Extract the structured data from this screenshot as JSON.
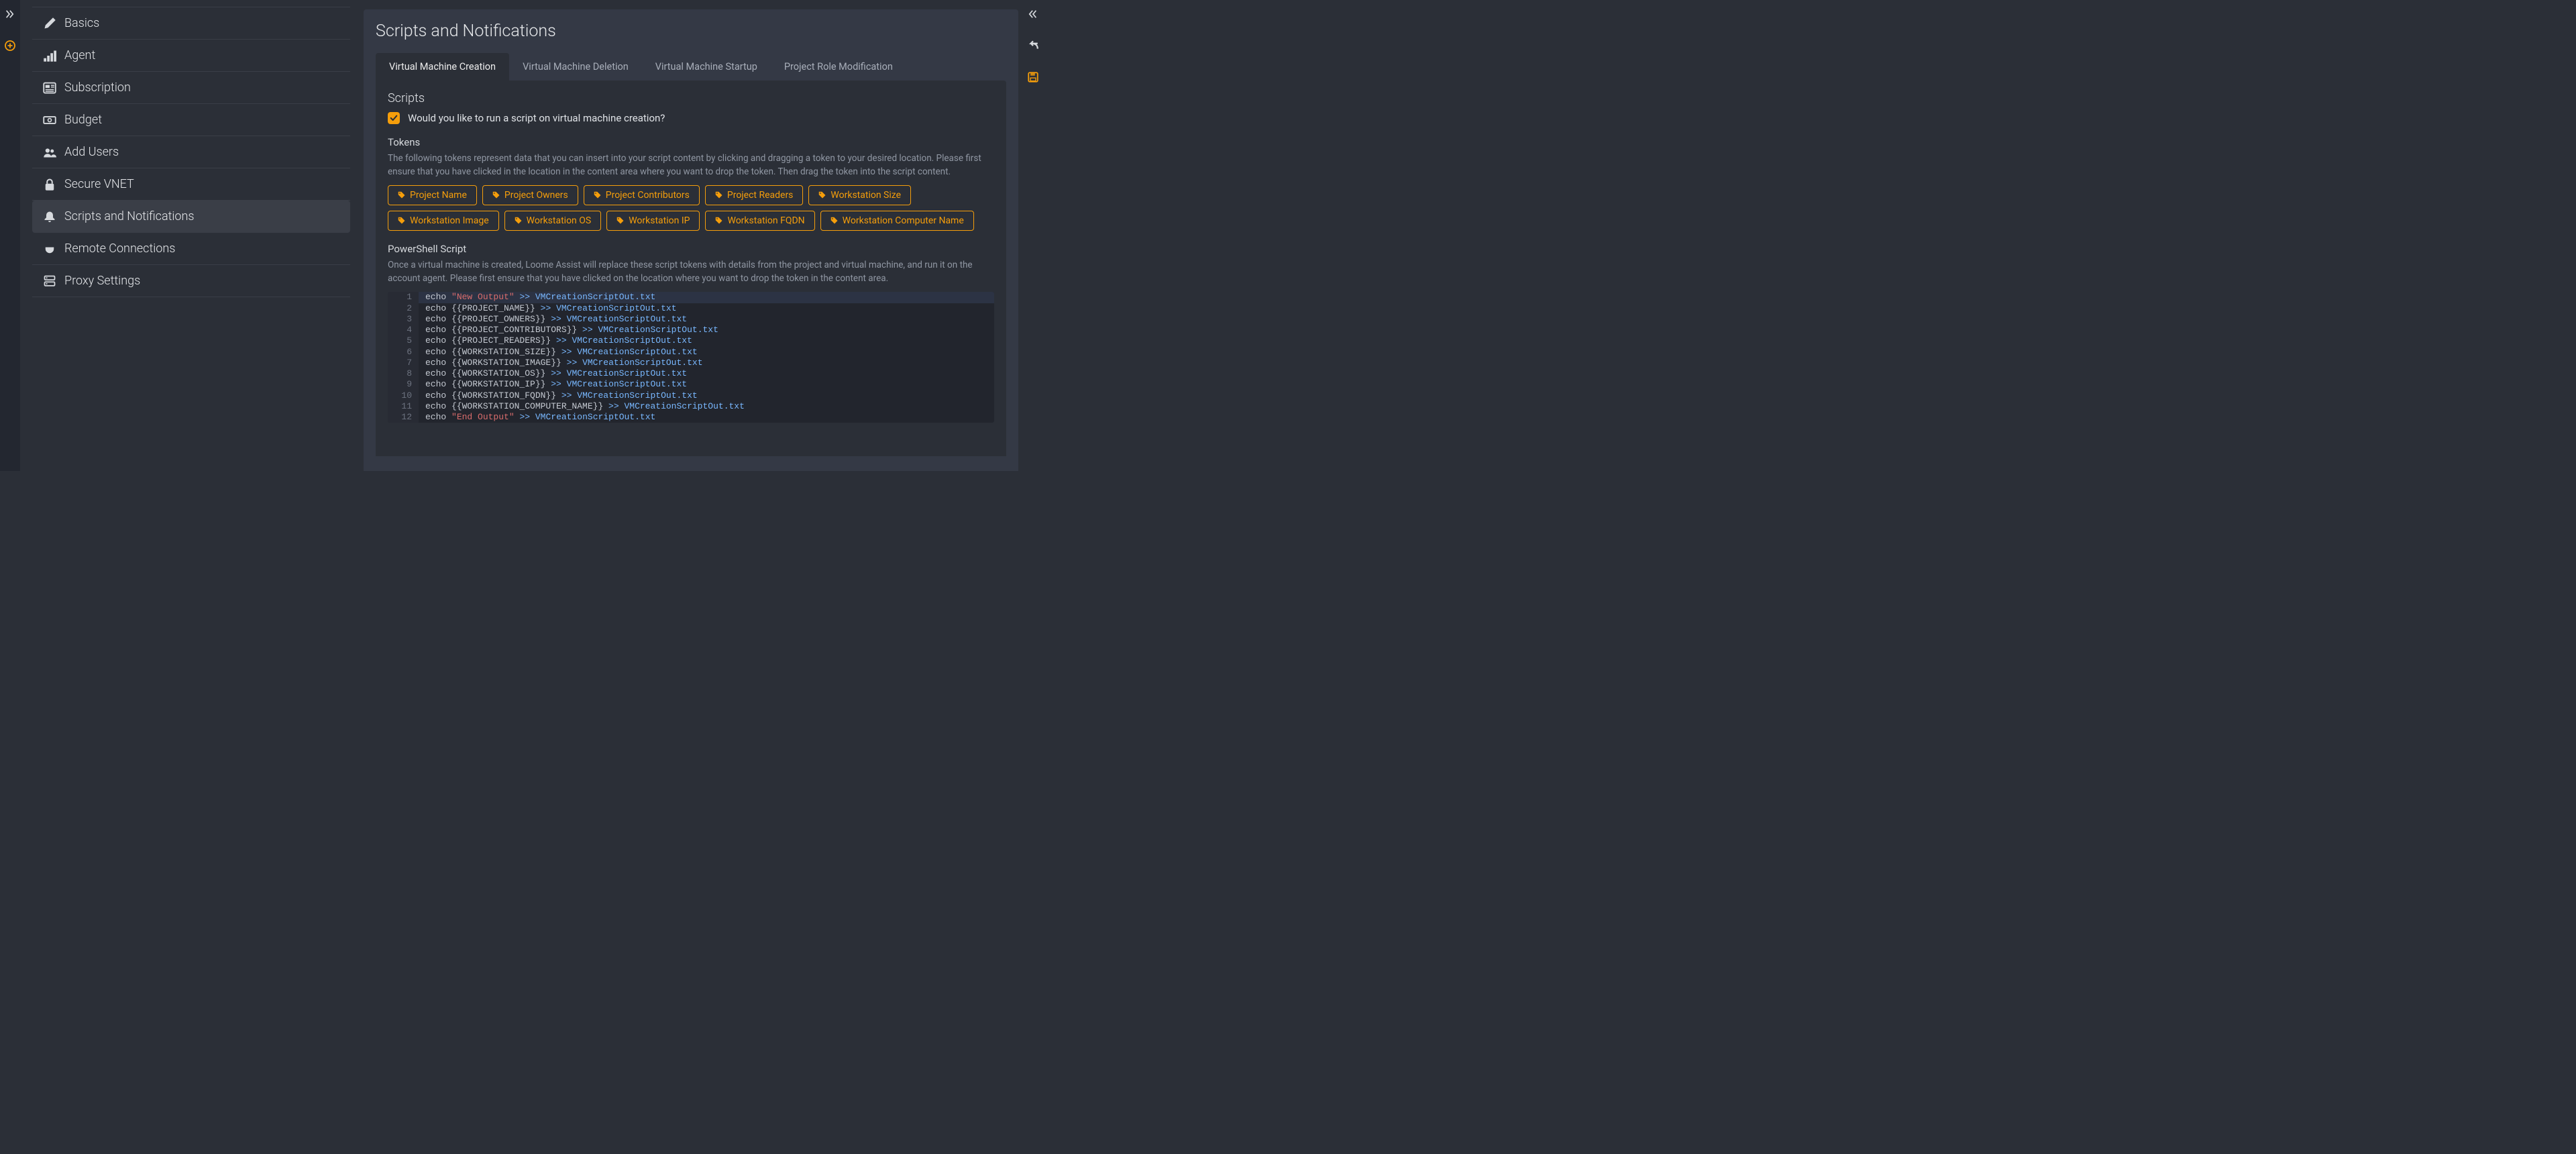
{
  "sidebar": {
    "items": [
      {
        "label": "Basics",
        "icon": "pencil",
        "active": false
      },
      {
        "label": "Agent",
        "icon": "chart-steps",
        "active": false
      },
      {
        "label": "Subscription",
        "icon": "newspaper",
        "active": false
      },
      {
        "label": "Budget",
        "icon": "money-bill",
        "active": false
      },
      {
        "label": "Add Users",
        "icon": "users",
        "active": false
      },
      {
        "label": "Secure VNET",
        "icon": "lock",
        "active": false
      },
      {
        "label": "Scripts and Notifications",
        "icon": "bell",
        "active": true
      },
      {
        "label": "Remote Connections",
        "icon": "plug",
        "active": false
      },
      {
        "label": "Proxy Settings",
        "icon": "server",
        "active": false
      }
    ]
  },
  "main": {
    "title": "Scripts and Notifications",
    "tabs": [
      {
        "label": "Virtual Machine Creation",
        "active": true
      },
      {
        "label": "Virtual Machine Deletion",
        "active": false
      },
      {
        "label": "Virtual Machine Startup",
        "active": false
      },
      {
        "label": "Project Role Modification",
        "active": false
      }
    ],
    "scripts": {
      "heading": "Scripts",
      "checkbox_label": "Would you like to run a script on virtual machine creation?",
      "checked": true,
      "tokens_heading": "Tokens",
      "tokens_help": "The following tokens represent data that you can insert into your script content by clicking and dragging a token to your desired location. Please first ensure that you have clicked in the location in the content area where you want to drop the token. Then drag the token into the script content.",
      "tokens": [
        "Project Name",
        "Project Owners",
        "Project Contributors",
        "Project Readers",
        "Workstation Size",
        "Workstation Image",
        "Workstation OS",
        "Workstation IP",
        "Workstation FQDN",
        "Workstation Computer Name"
      ],
      "ps_heading": "PowerShell Script",
      "ps_help": "Once a virtual machine is created, Loome Assist will replace these script tokens with details from the project and virtual machine, and run it on the account agent. Please first ensure that you have clicked on the location where you want to drop the token in the content area.",
      "editor_lines": [
        {
          "n": 1,
          "hl": true,
          "parts": [
            [
              "kw",
              "echo "
            ],
            [
              "str",
              "\"New Output\""
            ],
            [
              "kw",
              " "
            ],
            [
              "op",
              ">>"
            ],
            [
              "kw",
              " "
            ],
            [
              "fn",
              "VMCreationScriptOut.txt"
            ]
          ]
        },
        {
          "n": 2,
          "parts": [
            [
              "kw",
              "echo {{PROJECT_NAME}} "
            ],
            [
              "op",
              ">>"
            ],
            [
              "kw",
              " "
            ],
            [
              "fn",
              "VMCreationScriptOut.txt"
            ]
          ]
        },
        {
          "n": 3,
          "parts": [
            [
              "kw",
              "echo {{PROJECT_OWNERS}} "
            ],
            [
              "op",
              ">>"
            ],
            [
              "kw",
              " "
            ],
            [
              "fn",
              "VMCreationScriptOut.txt"
            ]
          ]
        },
        {
          "n": 4,
          "parts": [
            [
              "kw",
              "echo {{PROJECT_CONTRIBUTORS}} "
            ],
            [
              "op",
              ">>"
            ],
            [
              "kw",
              " "
            ],
            [
              "fn",
              "VMCreationScriptOut.txt"
            ]
          ]
        },
        {
          "n": 5,
          "parts": [
            [
              "kw",
              "echo {{PROJECT_READERS}} "
            ],
            [
              "op",
              ">>"
            ],
            [
              "kw",
              " "
            ],
            [
              "fn",
              "VMCreationScriptOut.txt"
            ]
          ]
        },
        {
          "n": 6,
          "parts": [
            [
              "kw",
              "echo {{WORKSTATION_SIZE}} "
            ],
            [
              "op",
              ">>"
            ],
            [
              "kw",
              " "
            ],
            [
              "fn",
              "VMCreationScriptOut.txt"
            ]
          ]
        },
        {
          "n": 7,
          "parts": [
            [
              "kw",
              "echo {{WORKSTATION_IMAGE}} "
            ],
            [
              "op",
              ">>"
            ],
            [
              "kw",
              " "
            ],
            [
              "fn",
              "VMCreationScriptOut.txt"
            ]
          ]
        },
        {
          "n": 8,
          "parts": [
            [
              "kw",
              "echo {{WORKSTATION_OS}} "
            ],
            [
              "op",
              ">>"
            ],
            [
              "kw",
              " "
            ],
            [
              "fn",
              "VMCreationScriptOut.txt"
            ]
          ]
        },
        {
          "n": 9,
          "parts": [
            [
              "kw",
              "echo {{WORKSTATION_IP}} "
            ],
            [
              "op",
              ">>"
            ],
            [
              "kw",
              " "
            ],
            [
              "fn",
              "VMCreationScriptOut.txt"
            ]
          ]
        },
        {
          "n": 10,
          "parts": [
            [
              "kw",
              "echo {{WORKSTATION_FQDN}} "
            ],
            [
              "op",
              ">>"
            ],
            [
              "kw",
              " "
            ],
            [
              "fn",
              "VMCreationScriptOut.txt"
            ]
          ]
        },
        {
          "n": 11,
          "parts": [
            [
              "kw",
              "echo {{WORKSTATION_COMPUTER_NAME}} "
            ],
            [
              "op",
              ">>"
            ],
            [
              "kw",
              " "
            ],
            [
              "fn",
              "VMCreationScriptOut.txt"
            ]
          ]
        },
        {
          "n": 12,
          "parts": [
            [
              "kw",
              "echo "
            ],
            [
              "str",
              "\"End Output\""
            ],
            [
              "kw",
              " "
            ],
            [
              "op",
              ">>"
            ],
            [
              "kw",
              " "
            ],
            [
              "fn",
              "VMCreationScriptOut.txt"
            ]
          ]
        }
      ]
    }
  },
  "colors": {
    "accent": "#f59e0b"
  }
}
